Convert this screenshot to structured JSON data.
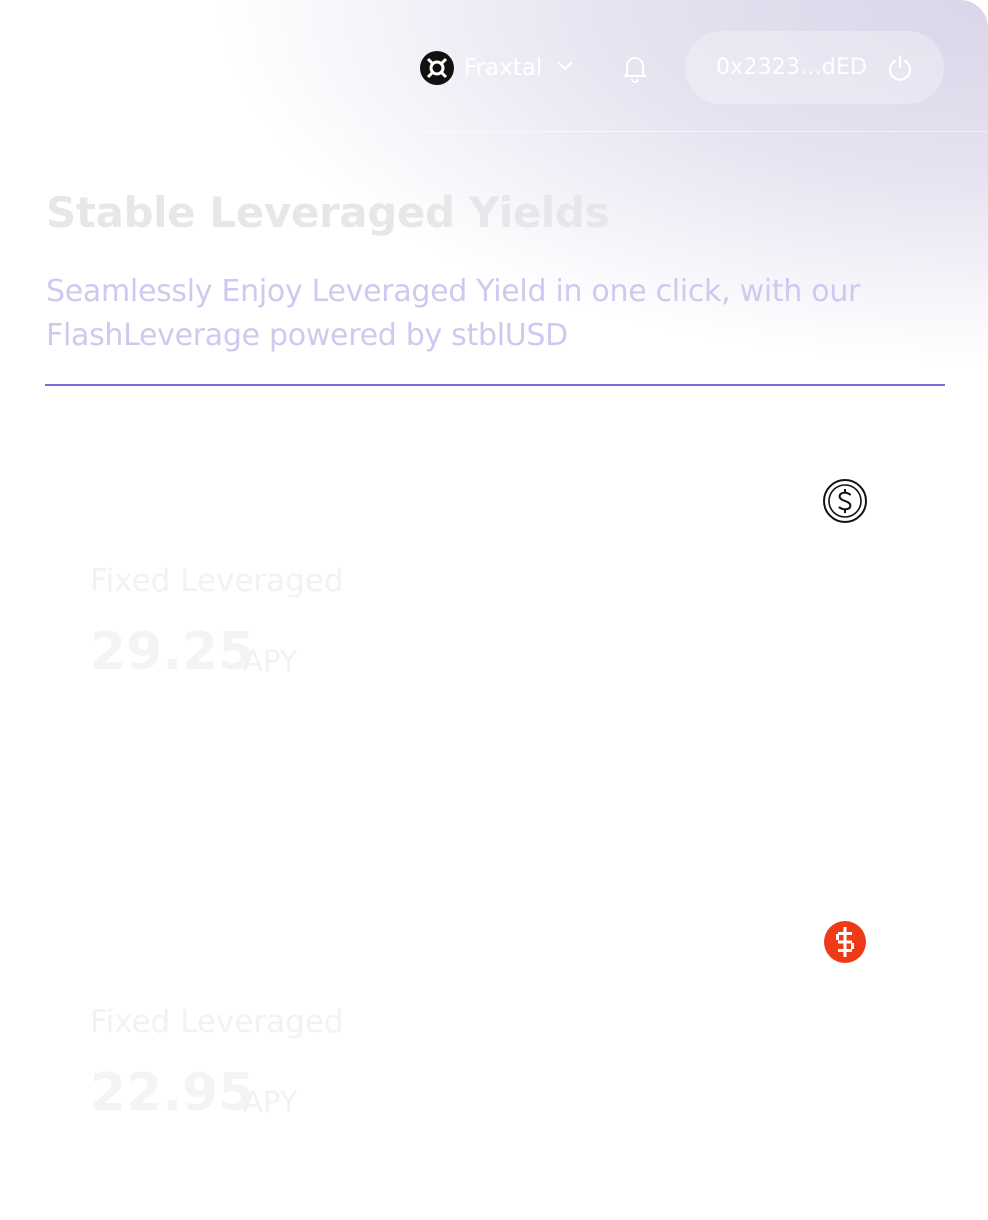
{
  "header": {
    "chain": {
      "name": "Fraxtal",
      "logo_icon": "fraxtal-logo-icon",
      "dropdown_icon": "chevron-down-icon"
    },
    "notifications_icon": "bell-icon",
    "wallet": {
      "address": "0x2323...dED",
      "disconnect_icon": "power-icon"
    }
  },
  "hero": {
    "title": "Stable Leveraged Yields",
    "subtitle": "Seamlessly Enjoy Leveraged Yield in one click, with our FlashLeverage powered by stblUSD",
    "accent_color": "#7a6ed8"
  },
  "cards": [
    {
      "icon": "usd-coin-icon",
      "label": "Fixed Leveraged",
      "value": "29.25",
      "unit": "APY"
    },
    {
      "icon": "usd-token-red-icon",
      "label": "Fixed Leveraged",
      "value": "22.95",
      "unit": "APY"
    }
  ]
}
